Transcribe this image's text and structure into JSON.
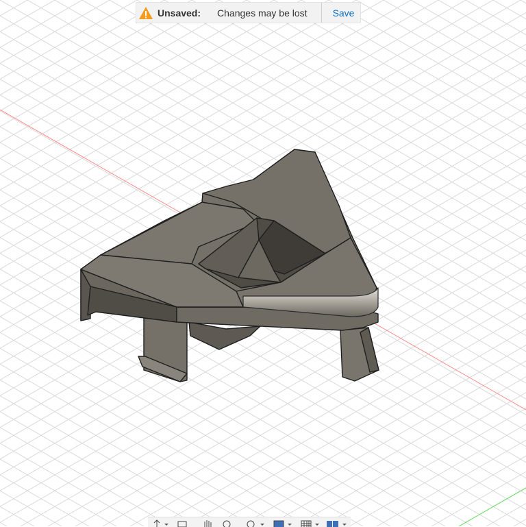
{
  "notification": {
    "icon": "warning-icon",
    "label": "Unsaved:",
    "message": "Changes may be lost",
    "save_label": "Save",
    "accent": "#0a6ebd",
    "warning_color": "#f29b1d"
  },
  "viewport": {
    "model_color": "#706b63",
    "axis_x_color": "#ff8080",
    "axis_y_color": "#66dd66",
    "grid_color": "#dcdcdc"
  },
  "navigation_toolbar": {
    "tools": [
      "orbit-icon",
      "look-at-icon",
      "pan-icon",
      "zoom-icon",
      "fit-icon",
      "display-settings-icon",
      "grid-settings-icon",
      "viewports-icon"
    ]
  }
}
